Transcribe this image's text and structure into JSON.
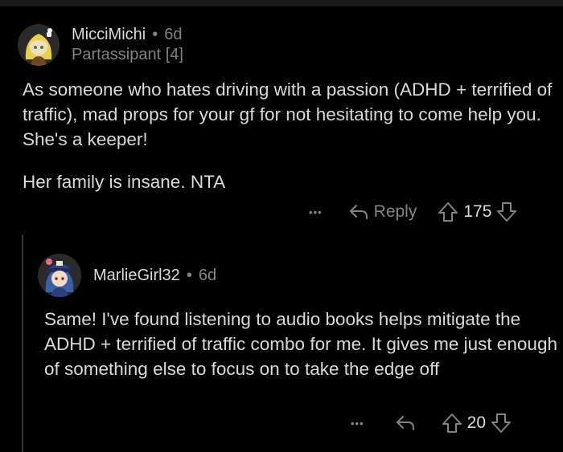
{
  "comments": [
    {
      "author": "MicciMichi",
      "age": "6d",
      "flair": "Partassipant [4]",
      "paragraphs": [
        "As someone who hates driving with a passion (ADHD + terrified of traffic), mad props for your gf for not hesitating to come help you. She's a keeper!",
        "Her family is insane. NTA"
      ],
      "more_label": "•••",
      "reply_label": "Reply",
      "score": "175"
    },
    {
      "author": "MarlieGirl32",
      "age": "6d",
      "paragraphs": [
        "Same! I've found listening to audio books helps mitigate the ADHD + terrified of traffic combo for me. It gives me just enough of something else to focus on to take the edge off"
      ],
      "more_label": "•••",
      "score": "20"
    }
  ],
  "separator": "•"
}
